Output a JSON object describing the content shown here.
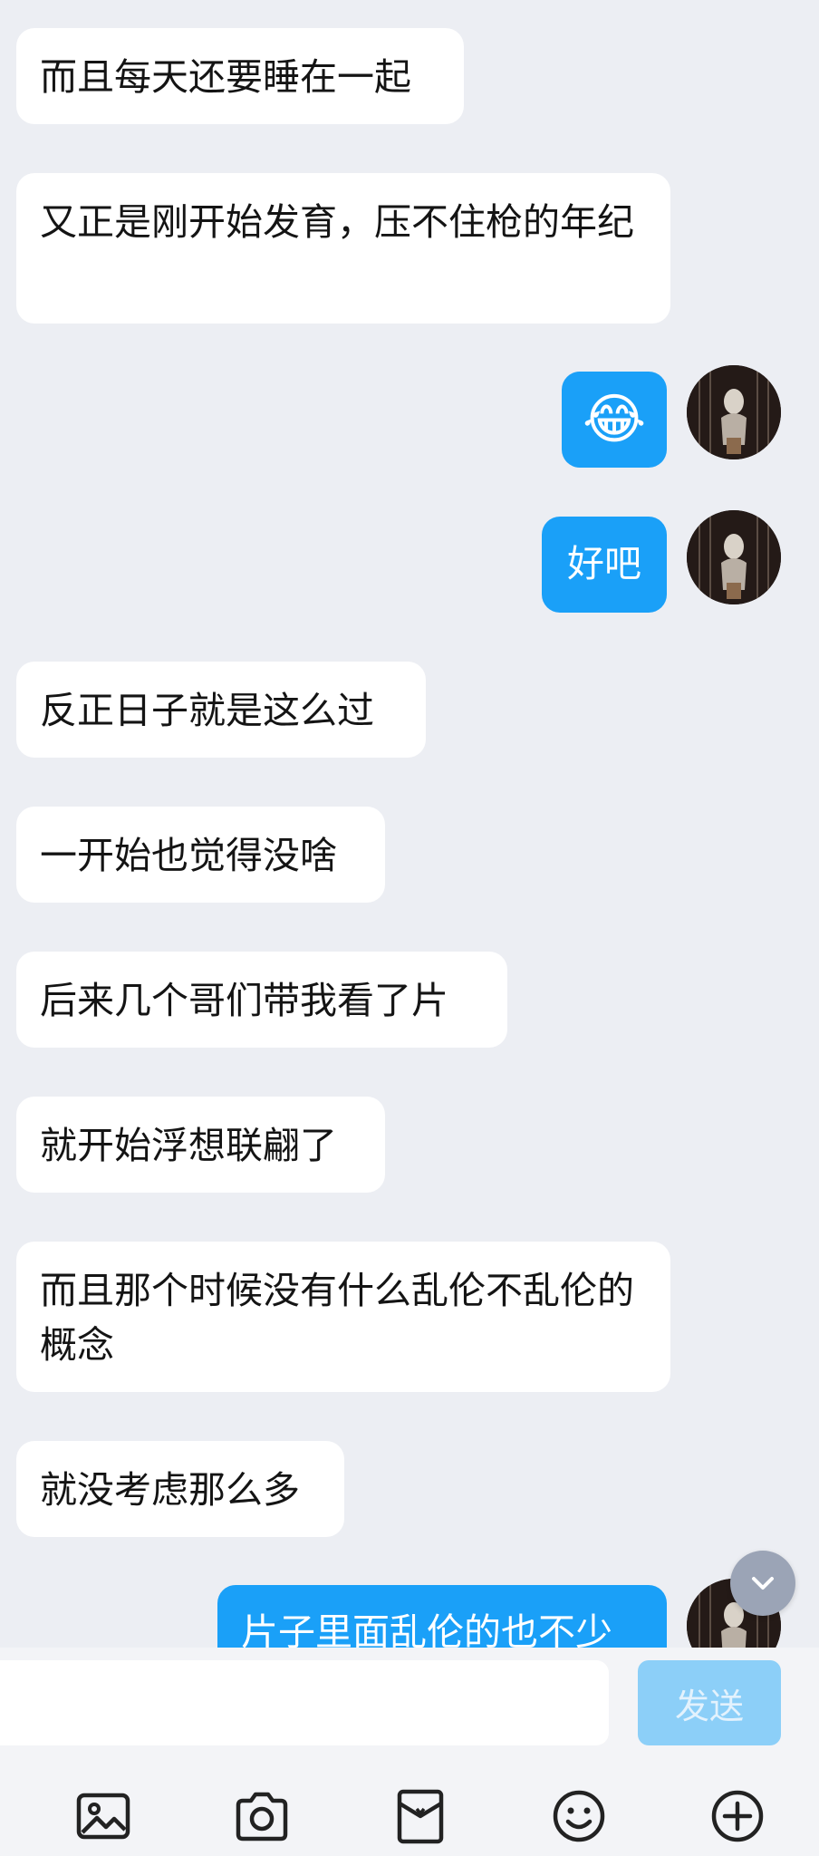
{
  "messages": [
    {
      "side": "left",
      "text": "而且每天还要睡在一起"
    },
    {
      "side": "left",
      "text": "又正是刚开始发育，压不住枪的年纪"
    },
    {
      "side": "right",
      "type": "emoji",
      "emoji": "😂"
    },
    {
      "side": "right",
      "text": "好吧"
    },
    {
      "side": "left",
      "text": "反正日子就是这么过"
    },
    {
      "side": "left",
      "text": "一开始也觉得没啥"
    },
    {
      "side": "left",
      "text": "后来几个哥们带我看了片"
    },
    {
      "side": "left",
      "text": "就开始浮想联翩了"
    },
    {
      "side": "left",
      "text": "而且那个时候没有什么乱伦不乱伦的概念"
    },
    {
      "side": "left",
      "text": "就没考虑那么多"
    },
    {
      "side": "right",
      "text": "片子里面乱伦的也不少"
    }
  ],
  "composer": {
    "input_value": "",
    "send_label": "发送"
  },
  "toolbar": {
    "icons": [
      "image-icon",
      "camera-icon",
      "red-packet-icon",
      "emoji-icon",
      "plus-icon"
    ]
  },
  "colors": {
    "background": "#eceef3",
    "incoming_bubble": "#ffffff",
    "outgoing_bubble": "#1aa0f8",
    "send_button": "#8ccff8"
  }
}
